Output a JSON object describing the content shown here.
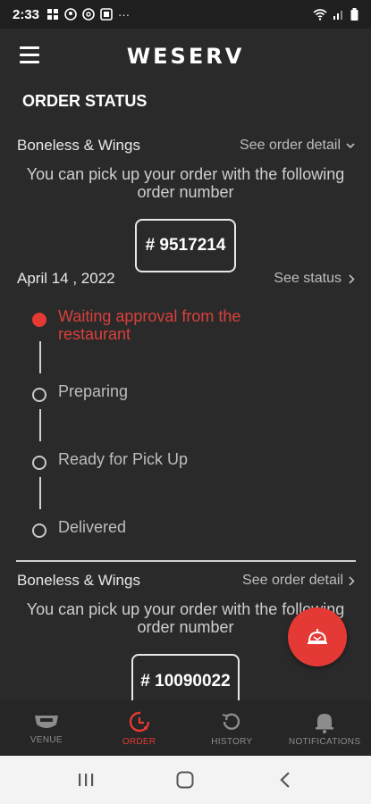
{
  "status_bar": {
    "time": "2:33",
    "overflow": "···"
  },
  "header": {
    "brand": "WESERV"
  },
  "page": {
    "title": "ORDER STATUS"
  },
  "order1": {
    "venue": "Boneless & Wings",
    "detail_link": "See order detail",
    "pickup_message": "You can pick up your order with the following order number",
    "order_number": "# 9517214"
  },
  "status_section": {
    "date": "April 14 , 2022",
    "status_link": "See status",
    "steps": [
      {
        "label": "Waiting approval from the restaurant",
        "active": true
      },
      {
        "label": "Preparing",
        "active": false
      },
      {
        "label": "Ready for Pick Up",
        "active": false
      },
      {
        "label": "Delivered",
        "active": false
      }
    ]
  },
  "order2": {
    "venue": "Boneless & Wings",
    "detail_link": "See order detail",
    "pickup_message": "You can pick up your order with the following order number",
    "order_number": "# 10090022"
  },
  "bottom_nav": {
    "items": [
      {
        "label": "VENUE",
        "icon": "venue-icon",
        "active": false
      },
      {
        "label": "ORDER",
        "icon": "order-timer-icon",
        "active": true
      },
      {
        "label": "HISTORY",
        "icon": "history-icon",
        "active": false
      },
      {
        "label": "NOTIFICATIONS",
        "icon": "bell-icon",
        "active": false
      }
    ]
  },
  "colors": {
    "background": "#2a2a2a",
    "accent": "#e53935",
    "text": "#e0e0e0"
  }
}
